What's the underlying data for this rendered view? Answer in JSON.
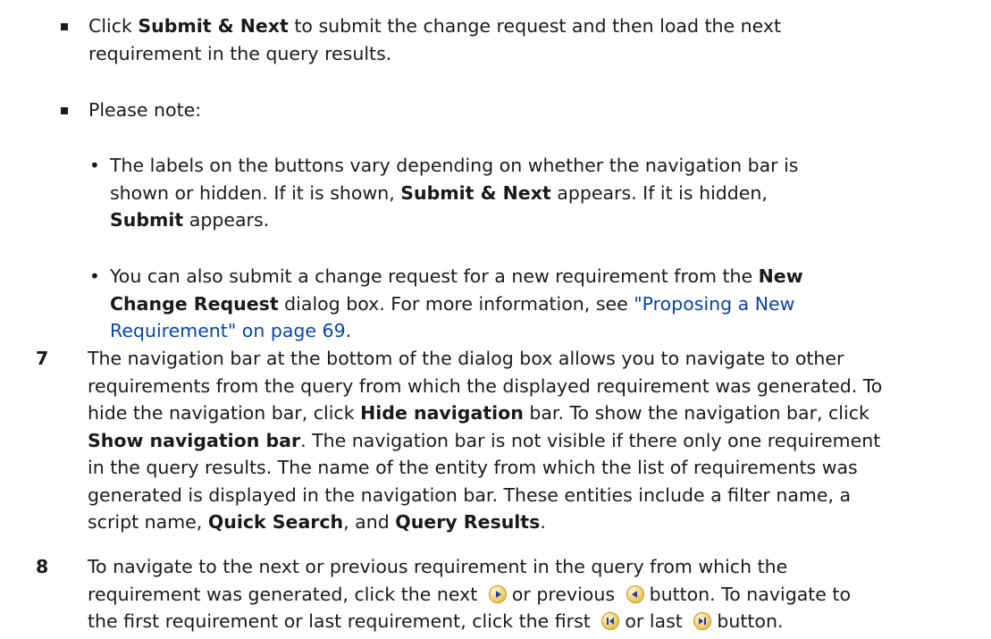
{
  "bullets": {
    "submit_next": {
      "pre": "Click ",
      "bold": "Submit & Next",
      "post_line1": " to submit the change request and then load the next",
      "post_line2": "requirement in the query results."
    },
    "please_note": "Please note:",
    "labels_note": {
      "line1": "The labels on the buttons vary depending on whether the navigation bar is",
      "line2_pre": "shown or hidden. If it is shown, ",
      "line2_bold": "Submit & Next",
      "line2_post": " appears. If it is hidden,",
      "line3_bold": "Submit",
      "line3_post": " appears."
    },
    "new_req_note": {
      "line1_pre": "You can also submit a change request for a new requirement from the ",
      "line1_bold": "New",
      "line2_bold": "Change Request",
      "line2_mid": " dialog box. For more information, see ",
      "line2_link": "\"Proposing a New",
      "line3_link": "Requirement\" on page 69",
      "line3_post": "."
    }
  },
  "steps": [
    {
      "number": "7",
      "line1": "The navigation bar at the bottom of the dialog box allows you to navigate to other",
      "line2": "requirements from the query from which the displayed requirement was generated. To",
      "line3_pre": "hide the navigation bar, click ",
      "line3_bold": "Hide navigation",
      "line3_post": " bar. To show the navigation bar, click",
      "line4_bold": "Show navigation bar",
      "line4_post": ". The navigation bar is not visible if there only one requirement",
      "line5": "in the query results. The name of the entity from which the list of requirements was",
      "line6": "generated is displayed in the navigation bar. These entities include a filter name, a",
      "line7_pre": "script name, ",
      "line7_bold1": "Quick Search",
      "line7_mid": ", and ",
      "line7_bold2": "Query Results",
      "line7_post": "."
    },
    {
      "number": "8",
      "line1": "To navigate to the next or previous requirement in the query from which the",
      "line2_pre": "requirement was generated, click the next",
      "line2_mid": "or previous",
      "line2_post": "button. To navigate to",
      "line3_pre": "the first requirement or last requirement, click the first",
      "line3_mid": "or last",
      "line3_post": "button."
    }
  ],
  "icons": {
    "next": "next-arrow-icon",
    "previous": "previous-arrow-icon",
    "first": "first-record-icon",
    "last": "last-record-icon"
  },
  "colors": {
    "text": "#1a1a1a",
    "link": "#0645ad",
    "icon_fill": "#f7d77a"
  }
}
